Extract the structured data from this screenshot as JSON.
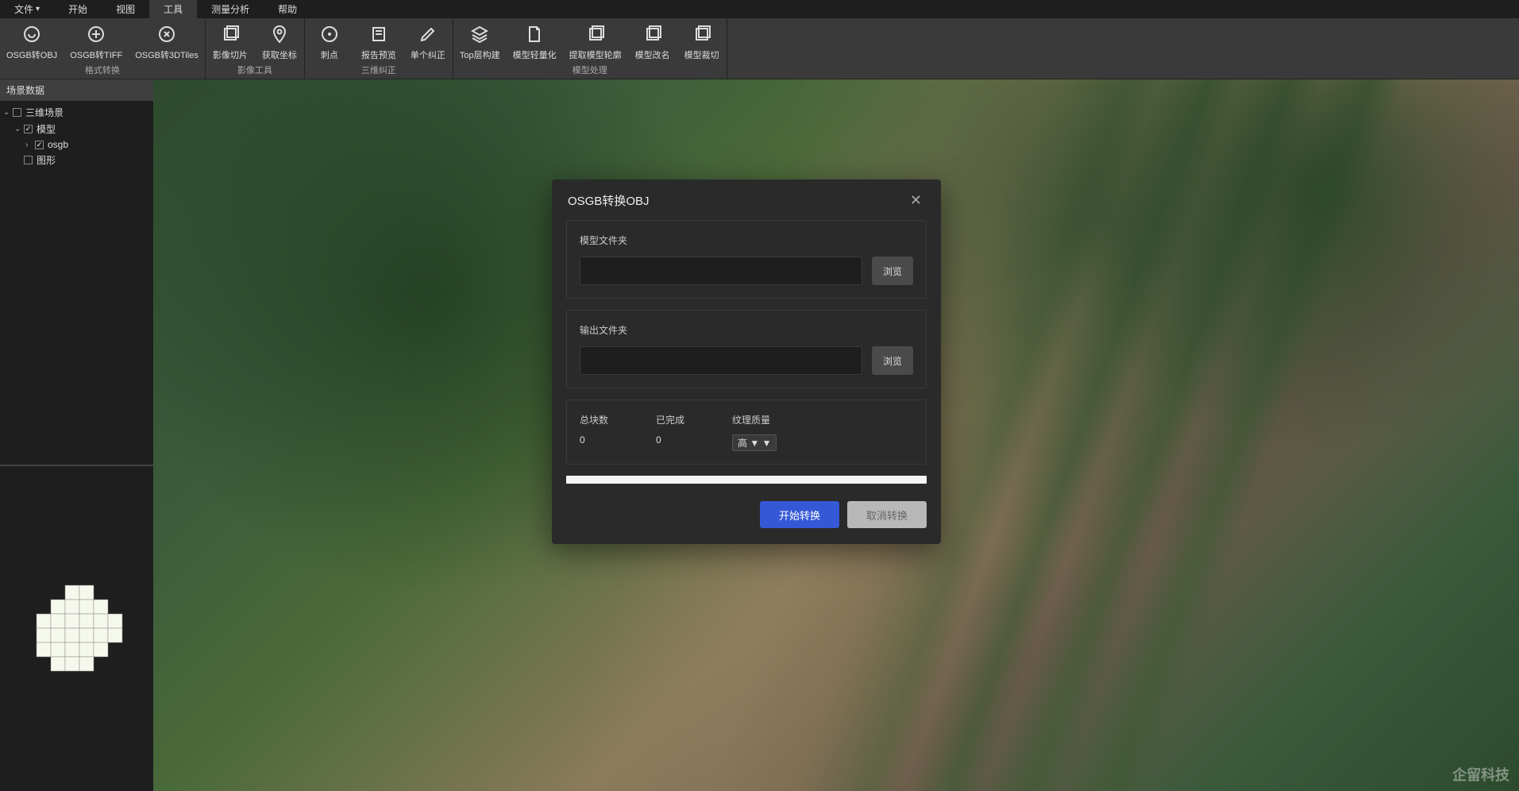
{
  "menubar": {
    "items": [
      "文件",
      "开始",
      "视图",
      "工具",
      "测量分析",
      "帮助"
    ],
    "active_index": 3
  },
  "toolbar": {
    "groups": [
      {
        "label": "格式转换",
        "tools": [
          {
            "label": "OSGB转OBJ",
            "icon": "convert-a-icon"
          },
          {
            "label": "OSGB转TIFF",
            "icon": "convert-b-icon"
          },
          {
            "label": "OSGB转3DTiles",
            "icon": "convert-c-icon"
          }
        ]
      },
      {
        "label": "影像工具",
        "tools": [
          {
            "label": "影像切片",
            "icon": "tile-icon"
          },
          {
            "label": "获取坐标",
            "icon": "pin-icon"
          }
        ]
      },
      {
        "label": "三维纠正",
        "tools": [
          {
            "label": "刺点",
            "icon": "target-icon"
          },
          {
            "label": "报告预览",
            "icon": "report-icon"
          },
          {
            "label": "单个纠正",
            "icon": "edit-icon"
          }
        ]
      },
      {
        "label": "模型处理",
        "tools": [
          {
            "label": "Top层构建",
            "icon": "layers-icon"
          },
          {
            "label": "模型轻量化",
            "icon": "document-icon"
          },
          {
            "label": "提取模型轮廓",
            "icon": "extract-icon"
          },
          {
            "label": "模型改名",
            "icon": "rename-icon"
          },
          {
            "label": "模型裁切",
            "icon": "crop-icon"
          }
        ]
      }
    ]
  },
  "sidebar": {
    "panel_title": "场景数据",
    "tree": [
      {
        "label": "三维场景",
        "indent": 0,
        "checked": false,
        "expanded": true
      },
      {
        "label": "模型",
        "indent": 1,
        "checked": true,
        "expanded": true
      },
      {
        "label": "osgb",
        "indent": 2,
        "checked": true,
        "expanded": false,
        "caret": true
      },
      {
        "label": "图形",
        "indent": 1,
        "checked": false,
        "expanded": false
      }
    ]
  },
  "dialog": {
    "title": "OSGB转换OBJ",
    "model_folder_label": "模型文件夹",
    "output_folder_label": "输出文件夹",
    "browse_label": "浏览",
    "total_blocks_label": "总块数",
    "total_blocks_value": "0",
    "completed_label": "已完成",
    "completed_value": "0",
    "texture_quality_label": "纹理质量",
    "texture_quality_value": "高",
    "start_button": "开始转换",
    "cancel_button": "取消转换"
  },
  "watermark": "企留科技"
}
